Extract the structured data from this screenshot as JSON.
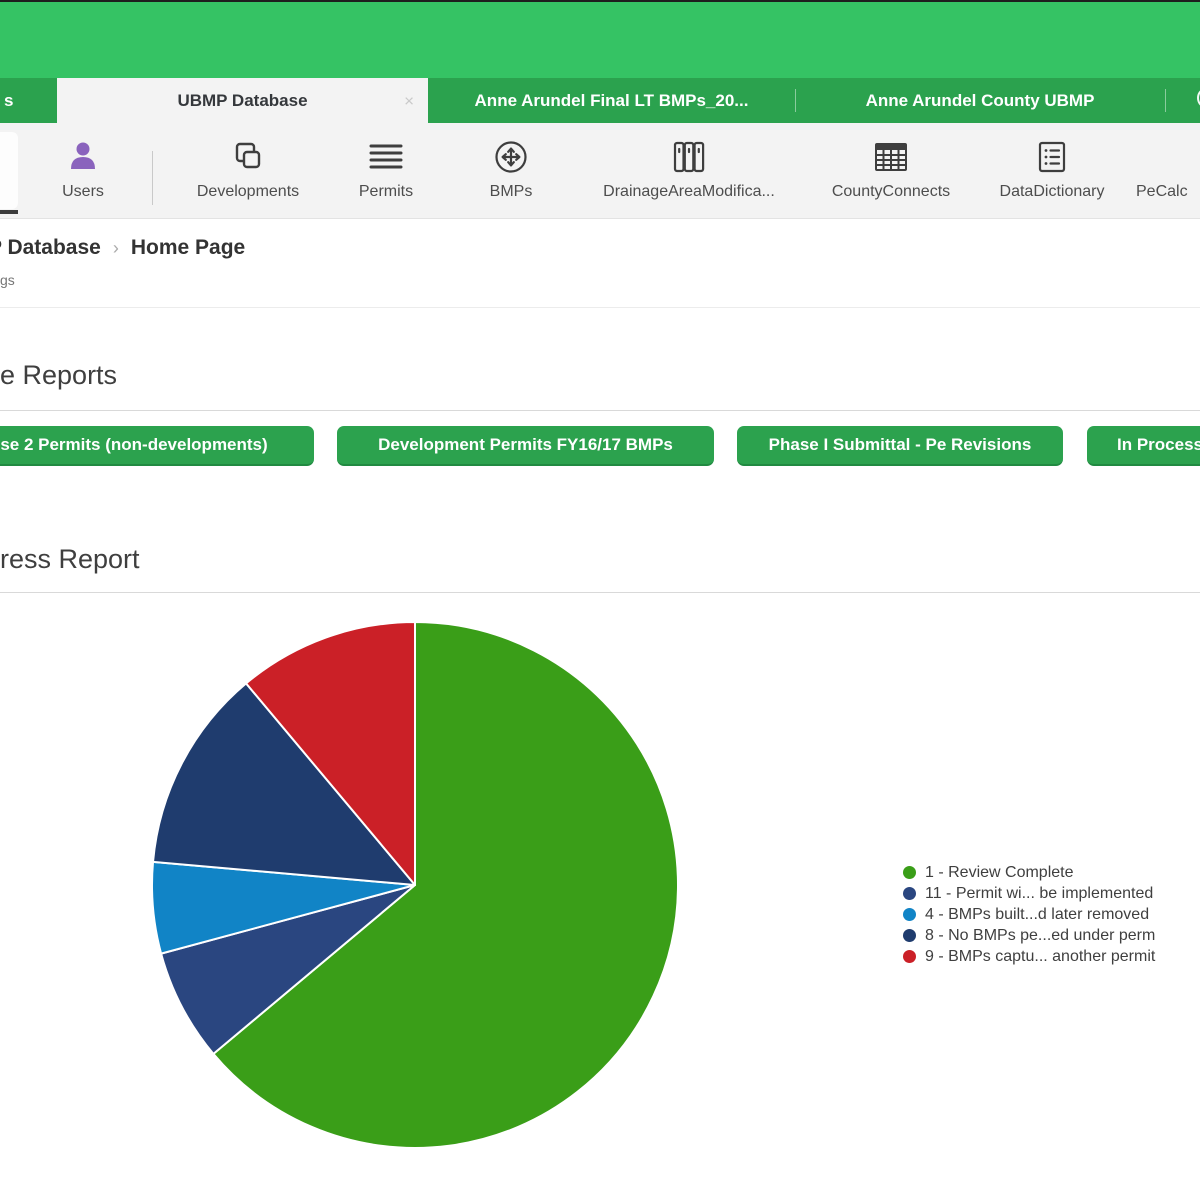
{
  "tab_bar": {
    "partial_tab_label": "s",
    "tabs": [
      {
        "label": "UBMP Database",
        "close_glyph": "×"
      },
      {
        "label": "Anne Arundel Final LT BMPs_20..."
      },
      {
        "label": "Anne Arundel County UBMP"
      }
    ]
  },
  "toolbar": {
    "items": [
      {
        "label": "Users"
      },
      {
        "label": "Developments"
      },
      {
        "label": "Permits"
      },
      {
        "label": "BMPs"
      },
      {
        "label": "DrainageAreaModifica..."
      },
      {
        "label": "CountyConnects"
      },
      {
        "label": "DataDictionary"
      },
      {
        "label": "PeCalc"
      }
    ]
  },
  "breadcrumb": {
    "parent_fragment": "P Database",
    "separator": "›",
    "current": "Home Page",
    "subtext_fragment": "gs"
  },
  "sections": {
    "reports_title_fragment": "e Reports",
    "buttons": [
      {
        "label": "se 2 Permits (non-developments)"
      },
      {
        "label": "Development Permits FY16/17 BMPs"
      },
      {
        "label": "Phase I Submittal - Pe Revisions"
      },
      {
        "label": "In Process"
      }
    ],
    "progress_title_fragment": "ress Report"
  },
  "chart_data": {
    "type": "pie",
    "title": "",
    "start_angle_deg": 0,
    "direction": "clockwise",
    "legend_position": "right",
    "slices": [
      {
        "label": "1 - Review Complete",
        "percent": 63.9,
        "color": "#3A9E18"
      },
      {
        "label": "11 - Permit wi... be implemented",
        "percent": 6.9,
        "color": "#2A4680"
      },
      {
        "label": "4 - BMPs built...d later removed",
        "percent": 5.6,
        "color": "#1184C6"
      },
      {
        "label": "8 - No BMPs pe...ed under perm",
        "percent": 12.5,
        "color": "#1F3C6E"
      },
      {
        "label": "9 - BMPs captu... another permit",
        "percent": 11.1,
        "color": "#CB2027"
      }
    ]
  },
  "colors": {
    "header_green": "#35c364",
    "tabbar_green": "#2ba24e",
    "button_green": "#2ca24e",
    "users_icon_purple": "#8a63bd",
    "slice_border": "#ffffff"
  }
}
